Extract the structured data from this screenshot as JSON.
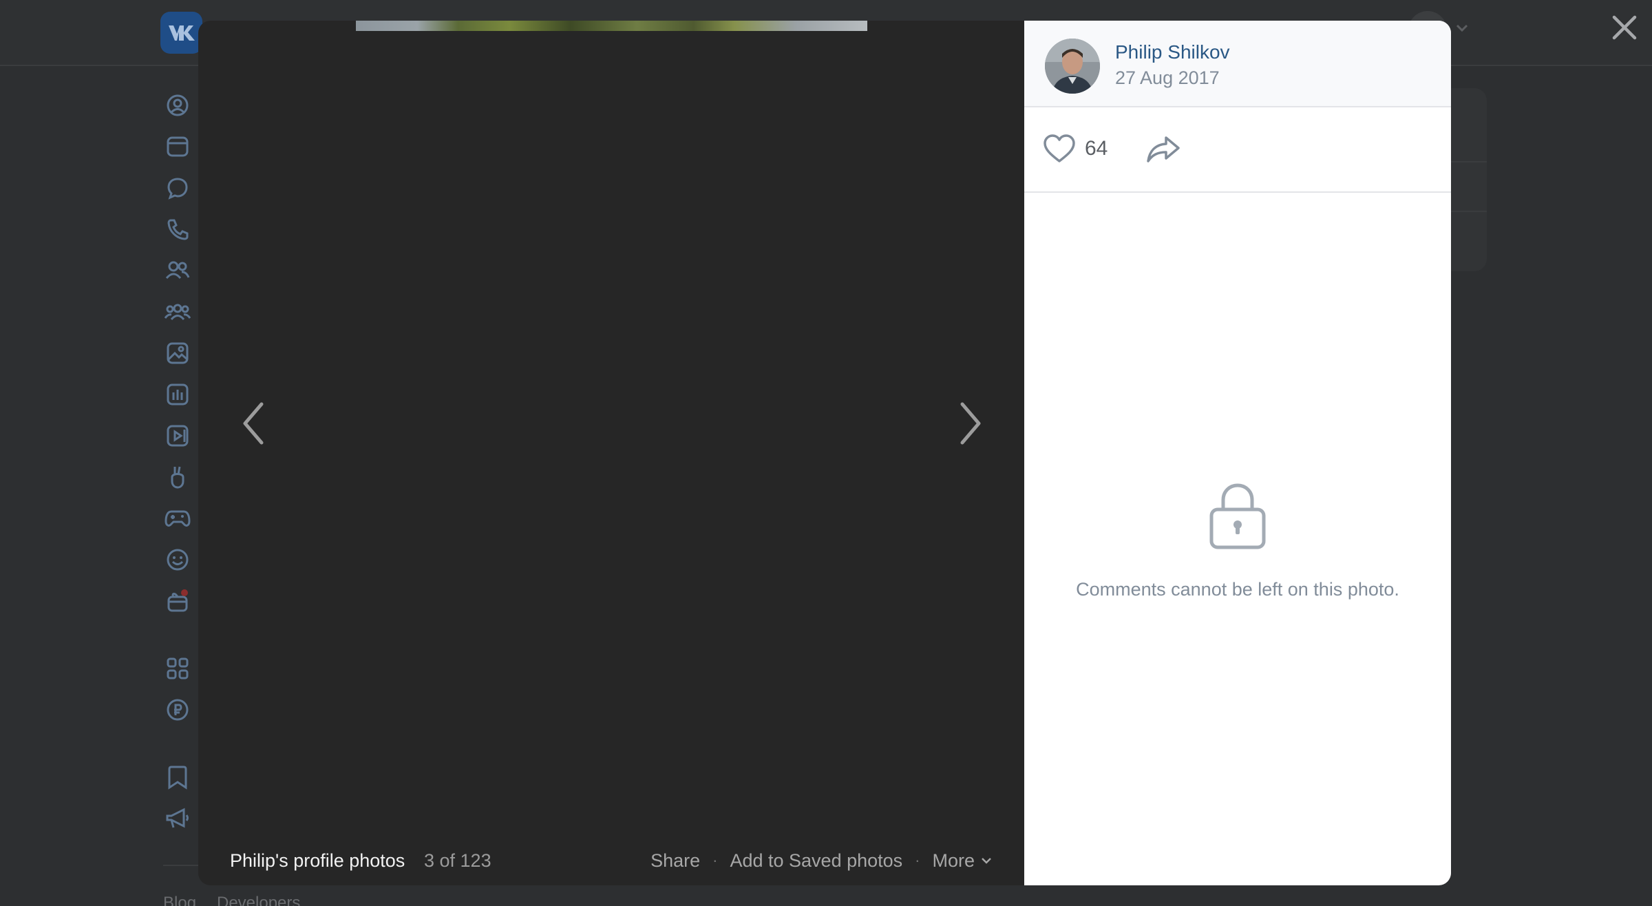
{
  "viewer": {
    "album_title": "Philip's profile photos",
    "counter": "3 of 123",
    "actions": {
      "share": "Share",
      "add_saved": "Add to Saved photos",
      "more": "More"
    }
  },
  "post": {
    "author": "Philip Shilkov",
    "date": "27 Aug 2017",
    "likes": "64"
  },
  "comments": {
    "locked_message": "Comments cannot be left on this photo."
  },
  "background_page": {
    "footer_links": [
      "Blog",
      "Developers"
    ]
  },
  "icons": {
    "sidebar": [
      "profile-icon",
      "news-icon",
      "messenger-icon",
      "calls-icon",
      "friends-icon",
      "communities-icon",
      "photos-icon",
      "music-icon",
      "video-icon",
      "clips-icon",
      "games-icon",
      "stickers-icon",
      "gifts-icon",
      "apps-icon",
      "payments-icon",
      "bookmarks-icon",
      "ads-icon"
    ]
  },
  "colors": {
    "accent_link": "#2a5885",
    "muted_text": "#818c99",
    "viewer_bg": "#262626",
    "notification_dot": "#8b2d2d"
  }
}
